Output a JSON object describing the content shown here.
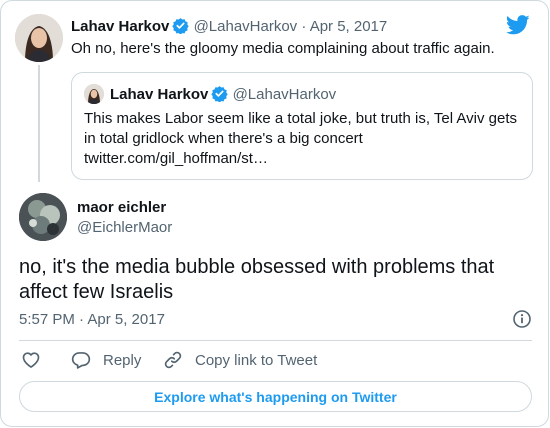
{
  "parent_tweet": {
    "display_name": "Lahav Harkov",
    "handle": "@LahavHarkov",
    "separator": "·",
    "date": "Apr 5, 2017",
    "text": "Oh no, here's the gloomy media complaining about traffic again."
  },
  "quoted_tweet": {
    "display_name": "Lahav Harkov",
    "handle": "@LahavHarkov",
    "lines": [
      "This makes Labor seem like a total joke, but truth is, Tel Aviv gets",
      "in total gridlock when there's a big concert",
      "twitter.com/gil_hoffman/st…"
    ]
  },
  "reply_tweet": {
    "display_name": "maor eichler",
    "handle": "@EichlerMaor",
    "lines": [
      "no, it's the media bubble obsessed with problems that",
      "affect few Israelis"
    ],
    "timestamp": "5:57 PM · Apr 5, 2017"
  },
  "actions": {
    "reply_label": "Reply",
    "copy_link_label": "Copy link to Tweet"
  },
  "explore_label": "Explore what's happening on Twitter",
  "colors": {
    "brand_blue": "#1d9bf0",
    "text": "#0f1419",
    "muted": "#536471",
    "border": "#cfd9de"
  }
}
